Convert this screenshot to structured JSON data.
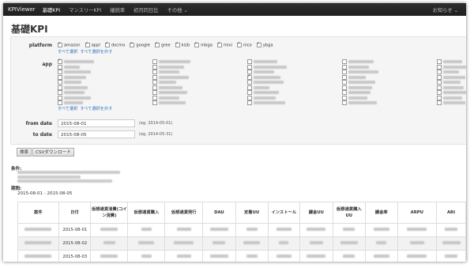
{
  "navbar": {
    "brand": "KPIViewer",
    "links": [
      {
        "label": "基礎KPI",
        "active": true
      },
      {
        "label": "マンスリーKPI",
        "active": false
      },
      {
        "label": "継続率",
        "active": false
      },
      {
        "label": "初月同日比",
        "active": false
      },
      {
        "label": "その他 ⌄",
        "active": false
      }
    ],
    "user_menu": "お知らせ ⌄"
  },
  "page_title": "基礎KPI",
  "filters": {
    "platform_label": "platform",
    "platforms": [
      "amazon",
      "appl",
      "docmo",
      "google",
      "gree",
      "kizb",
      "mbga",
      "mixi",
      "nico",
      "ybga"
    ],
    "select_all": "すべて選択",
    "deselect_all": "すべて選択を外す",
    "app_label": "app",
    "from_label": "from date",
    "from_value": "2015-08-01",
    "from_hint": "(eg. 2014-05-01)",
    "to_label": "to date",
    "to_value": "2015-08-05",
    "to_hint": "(eg. 2014-05-31)"
  },
  "actions": {
    "search": "検索",
    "csv": "CSVダウンロード"
  },
  "conditions": {
    "label": "条件:",
    "period_label": "期間:",
    "period_value": "2015-08-01 - 2015-08-05"
  },
  "table": {
    "headers": [
      "案件",
      "日付",
      "仮想通貨消費(コイン消費)",
      "仮想通貨購入",
      "仮想通貨発行",
      "DAU",
      "定着UU",
      "インストール",
      "課金UU",
      "仮想通貨購入UU",
      "課金率",
      "ARPU",
      "ARI"
    ],
    "dates": [
      "2015-08-01",
      "2015-08-02",
      "2015-08-03"
    ]
  },
  "colors": {
    "navbar": "#262626",
    "link": "#2a6ebd",
    "panel": "#f5f5f5"
  }
}
